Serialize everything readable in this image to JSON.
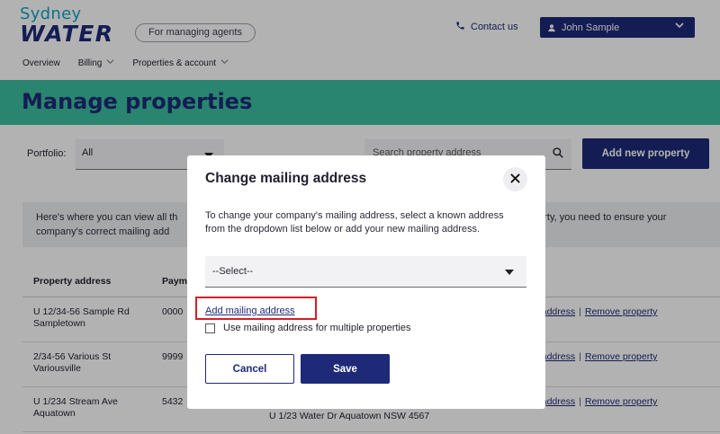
{
  "header": {
    "logo_line1": "Sydney",
    "logo_line2": "WATER",
    "agent_pill": "For managing agents",
    "contact": "Contact us",
    "user": "John Sample",
    "nav": [
      "Overview",
      "Billing",
      "Properties & account"
    ]
  },
  "page_title": "Manage properties",
  "toolbar": {
    "portfolio_label": "Portfolio:",
    "portfolio_value": "All",
    "search_placeholder": "Search property address",
    "add_property": "Add new property"
  },
  "info": {
    "left": "Here's where you can view all th",
    "left2": "company's correct mailing add",
    "right": "perty, you need to ensure your"
  },
  "table": {
    "headers": [
      "Property address",
      "Paym"
    ],
    "rows": [
      {
        "addr1": "U 12/34-56 Sample Rd",
        "addr2": "Sampletown",
        "pay": "0000",
        "action1": "g address",
        "action2": "Remove property",
        "mail": ""
      },
      {
        "addr1": "2/34-56 Various St",
        "addr2": "Variousville",
        "pay": "9999",
        "action1": "g address",
        "action2": "Remove property",
        "mail": ""
      },
      {
        "addr1": "U 1/234 Stream Ave",
        "addr2": "Aquatown",
        "pay": "5432",
        "action1": "g address",
        "action2": "Remove property",
        "mail": "U 1/23 Water Dr Aquatown NSW 4567"
      }
    ]
  },
  "modal": {
    "title": "Change mailing address",
    "description": "To change your company's mailing address, select a known address from the dropdown list below or add your new mailing address.",
    "select_value": "--Select--",
    "add_mailing": "Add mailing address",
    "multi_label": "Use mailing address for multiple properties",
    "cancel": "Cancel",
    "save": "Save"
  },
  "colors": {
    "brand_navy": "#1e2a78",
    "brand_green": "#3bbf9f",
    "highlight_red": "#d21f2a"
  }
}
